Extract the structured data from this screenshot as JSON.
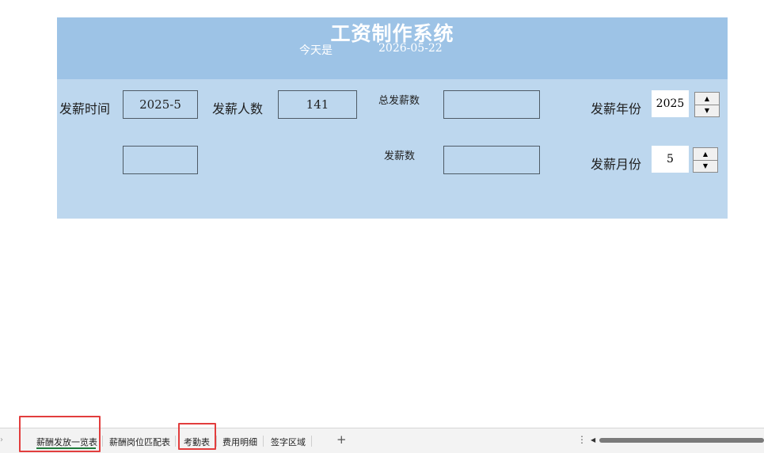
{
  "header": {
    "title": "工资制作系统",
    "today_label": "今天是",
    "today_date": "2026-05-22"
  },
  "form": {
    "pay_time_label": "发薪时间",
    "pay_time_value": "2025-5",
    "pay_count_label": "发薪人数",
    "pay_count_value": "141",
    "total_pay_label": "总发薪数",
    "total_pay_value": "",
    "extra_value": "",
    "pay_amount_label": "发薪数",
    "pay_amount_value": "",
    "year_label": "发薪年份",
    "year_value": "2025",
    "month_label": "发薪月份",
    "month_value": "5"
  },
  "spinner_icons": {
    "up": "▲",
    "down": "▼"
  },
  "sheet_tabs": [
    {
      "label": "薪酬发放一览表",
      "active": true
    },
    {
      "label": "薪酬岗位匹配表",
      "active": false
    },
    {
      "label": "考勤表",
      "active": false
    },
    {
      "label": "费用明细",
      "active": false
    },
    {
      "label": "签字区域",
      "active": false
    }
  ],
  "tabbar": {
    "add_sheet": "+",
    "more": "⋮",
    "scroll_left": "◀",
    "nav_prev": "›"
  },
  "colors": {
    "header_bg": "#9dc3e6",
    "panel_bg": "#bdd7ee",
    "highlight": "#e23d3d",
    "active_tab_underline": "#1f7a3a"
  }
}
